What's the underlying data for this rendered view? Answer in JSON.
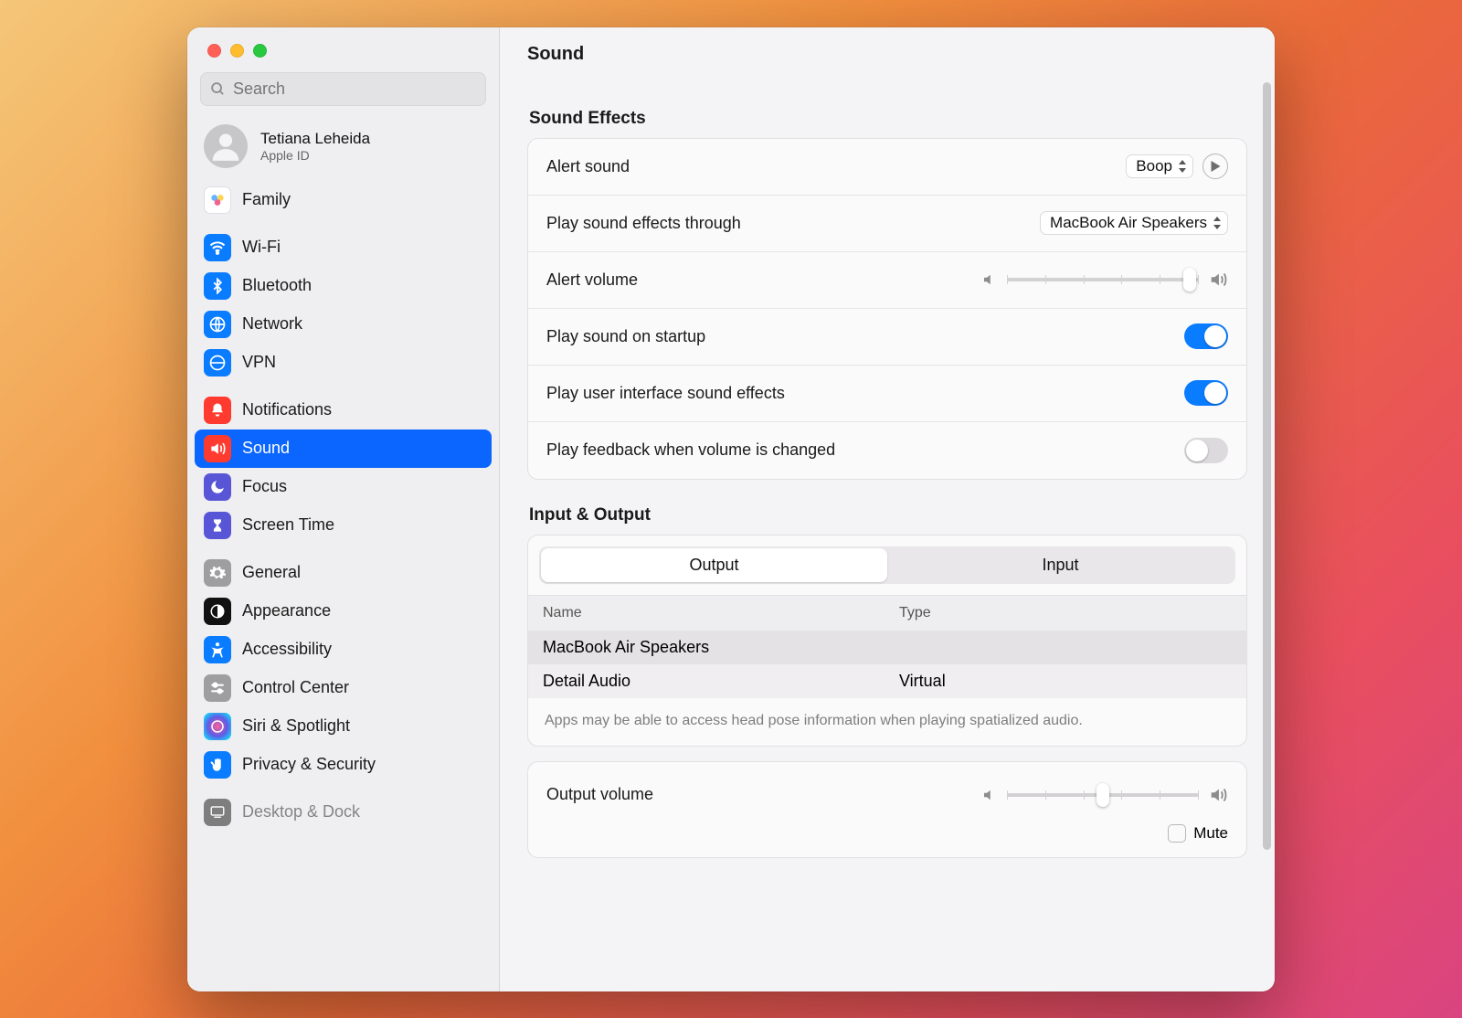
{
  "search": {
    "placeholder": "Search"
  },
  "account": {
    "name": "Tetiana Leheida",
    "sub": "Apple ID"
  },
  "sidebar_family": "Family",
  "sidebar": {
    "net": [
      "Wi-Fi",
      "Bluetooth",
      "Network",
      "VPN"
    ],
    "focus": [
      "Notifications",
      "Sound",
      "Focus",
      "Screen Time"
    ],
    "gen": [
      "General",
      "Appearance",
      "Accessibility",
      "Control Center",
      "Siri & Spotlight",
      "Privacy & Security"
    ],
    "last": "Desktop & Dock"
  },
  "header": {
    "title": "Sound"
  },
  "sections": {
    "effects": "Sound Effects",
    "io": "Input & Output"
  },
  "effects": {
    "alert_sound": {
      "label": "Alert sound",
      "value": "Boop"
    },
    "play_through": {
      "label": "Play sound effects through",
      "value": "MacBook Air Speakers"
    },
    "alert_volume": {
      "label": "Alert volume",
      "pos": 95
    },
    "startup": {
      "label": "Play sound on startup",
      "on": true
    },
    "ui_sounds": {
      "label": "Play user interface sound effects",
      "on": true
    },
    "feedback": {
      "label": "Play feedback when volume is changed",
      "on": false
    }
  },
  "io": {
    "tabs": [
      "Output",
      "Input"
    ],
    "cols": {
      "name": "Name",
      "type": "Type"
    },
    "rows": [
      {
        "name": "MacBook Air Speakers",
        "type": ""
      },
      {
        "name": "Detail Audio",
        "type": "Virtual"
      }
    ],
    "note": "Apps may be able to access head pose information when playing spatialized audio.",
    "output_volume": {
      "label": "Output volume",
      "pos": 50
    },
    "mute": "Mute"
  }
}
